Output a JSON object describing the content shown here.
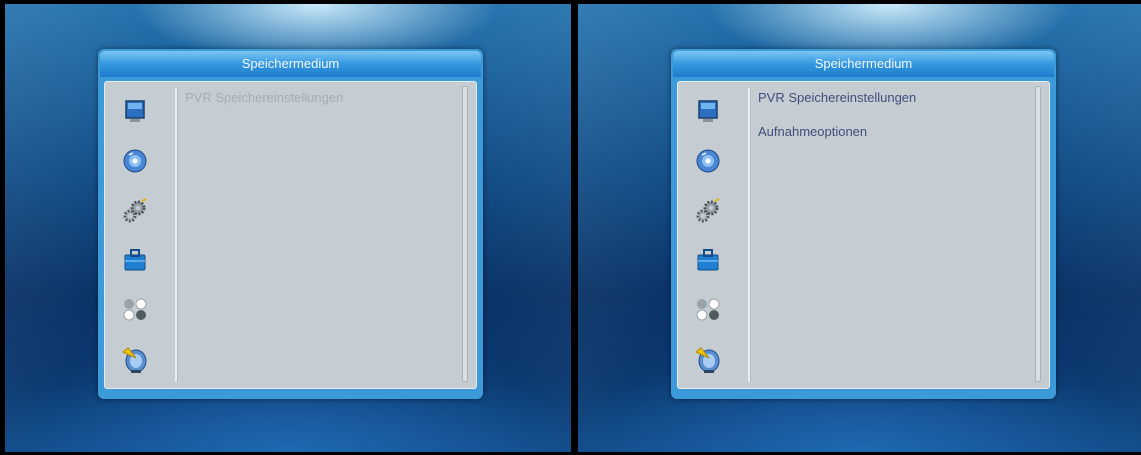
{
  "screens": [
    {
      "title": "Speichermedium",
      "menu": [
        {
          "label": "PVR Speichereinstellungen",
          "state": "disabled"
        }
      ]
    },
    {
      "title": "Speichermedium",
      "menu": [
        {
          "label": "PVR Speichereinstellungen",
          "state": "enabled"
        },
        {
          "label": "Aufnahmeoptionen",
          "state": "enabled"
        }
      ]
    }
  ],
  "side_icons": [
    "tv-monitor-icon",
    "disc-icon",
    "gears-icon",
    "toolbox-icon",
    "balls-icon",
    "satellite-dish-icon"
  ],
  "colors": {
    "window_frame": "#3d9ad8",
    "panel_bg": "#c5cdd2",
    "enabled_text": "#3f4f7c",
    "disabled_text": "#a6adb2"
  }
}
